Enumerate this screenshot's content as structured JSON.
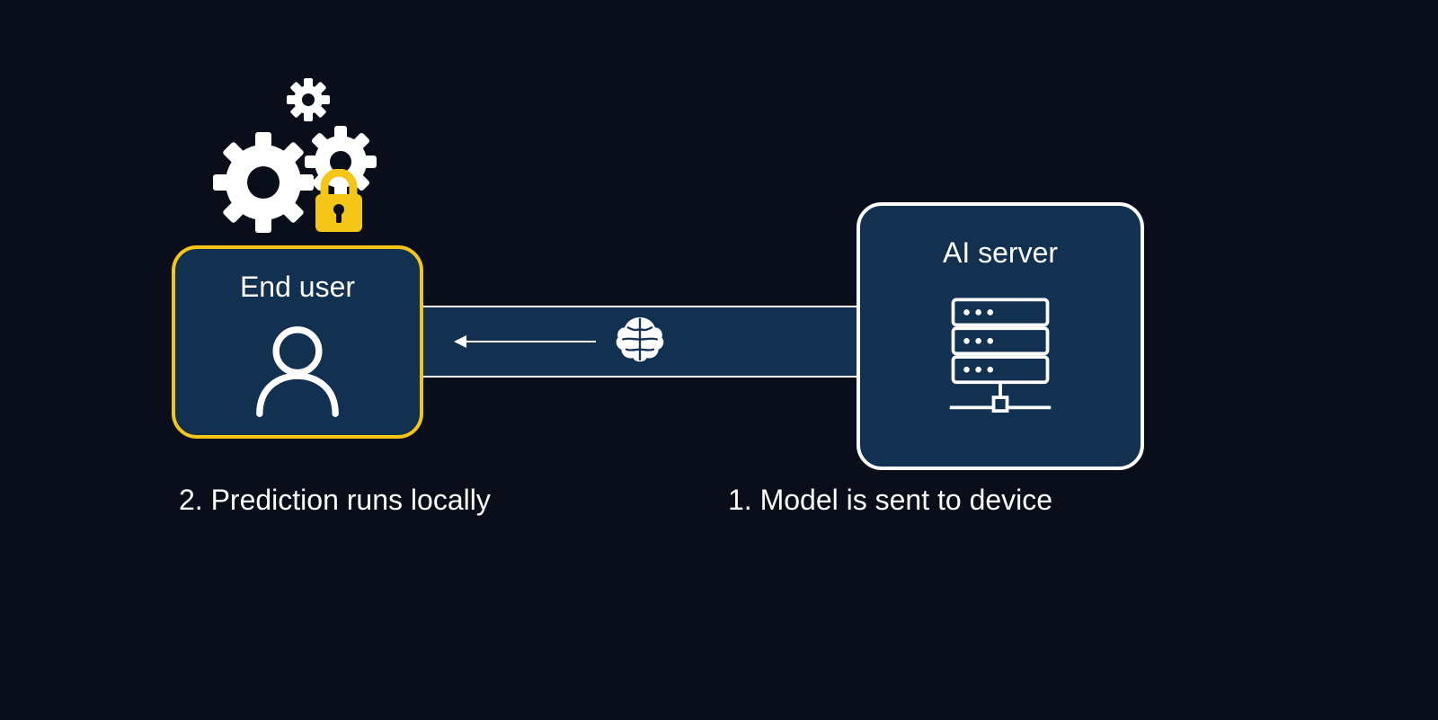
{
  "boxes": {
    "end_user": {
      "title": "End user"
    },
    "ai_server": {
      "title": "AI server"
    }
  },
  "captions": {
    "left": "2. Prediction runs locally",
    "right": "1. Model is sent to device"
  },
  "icons": {
    "gears": "gears-icon",
    "lock": "lock-icon",
    "user": "user-icon",
    "server": "server-icon",
    "brain": "brain-icon",
    "arrow": "arrow-left-icon"
  },
  "colors": {
    "background": "#0a0e1a",
    "box_fill": "#12304f",
    "accent_yellow": "#f5c518",
    "white": "#ffffff"
  }
}
